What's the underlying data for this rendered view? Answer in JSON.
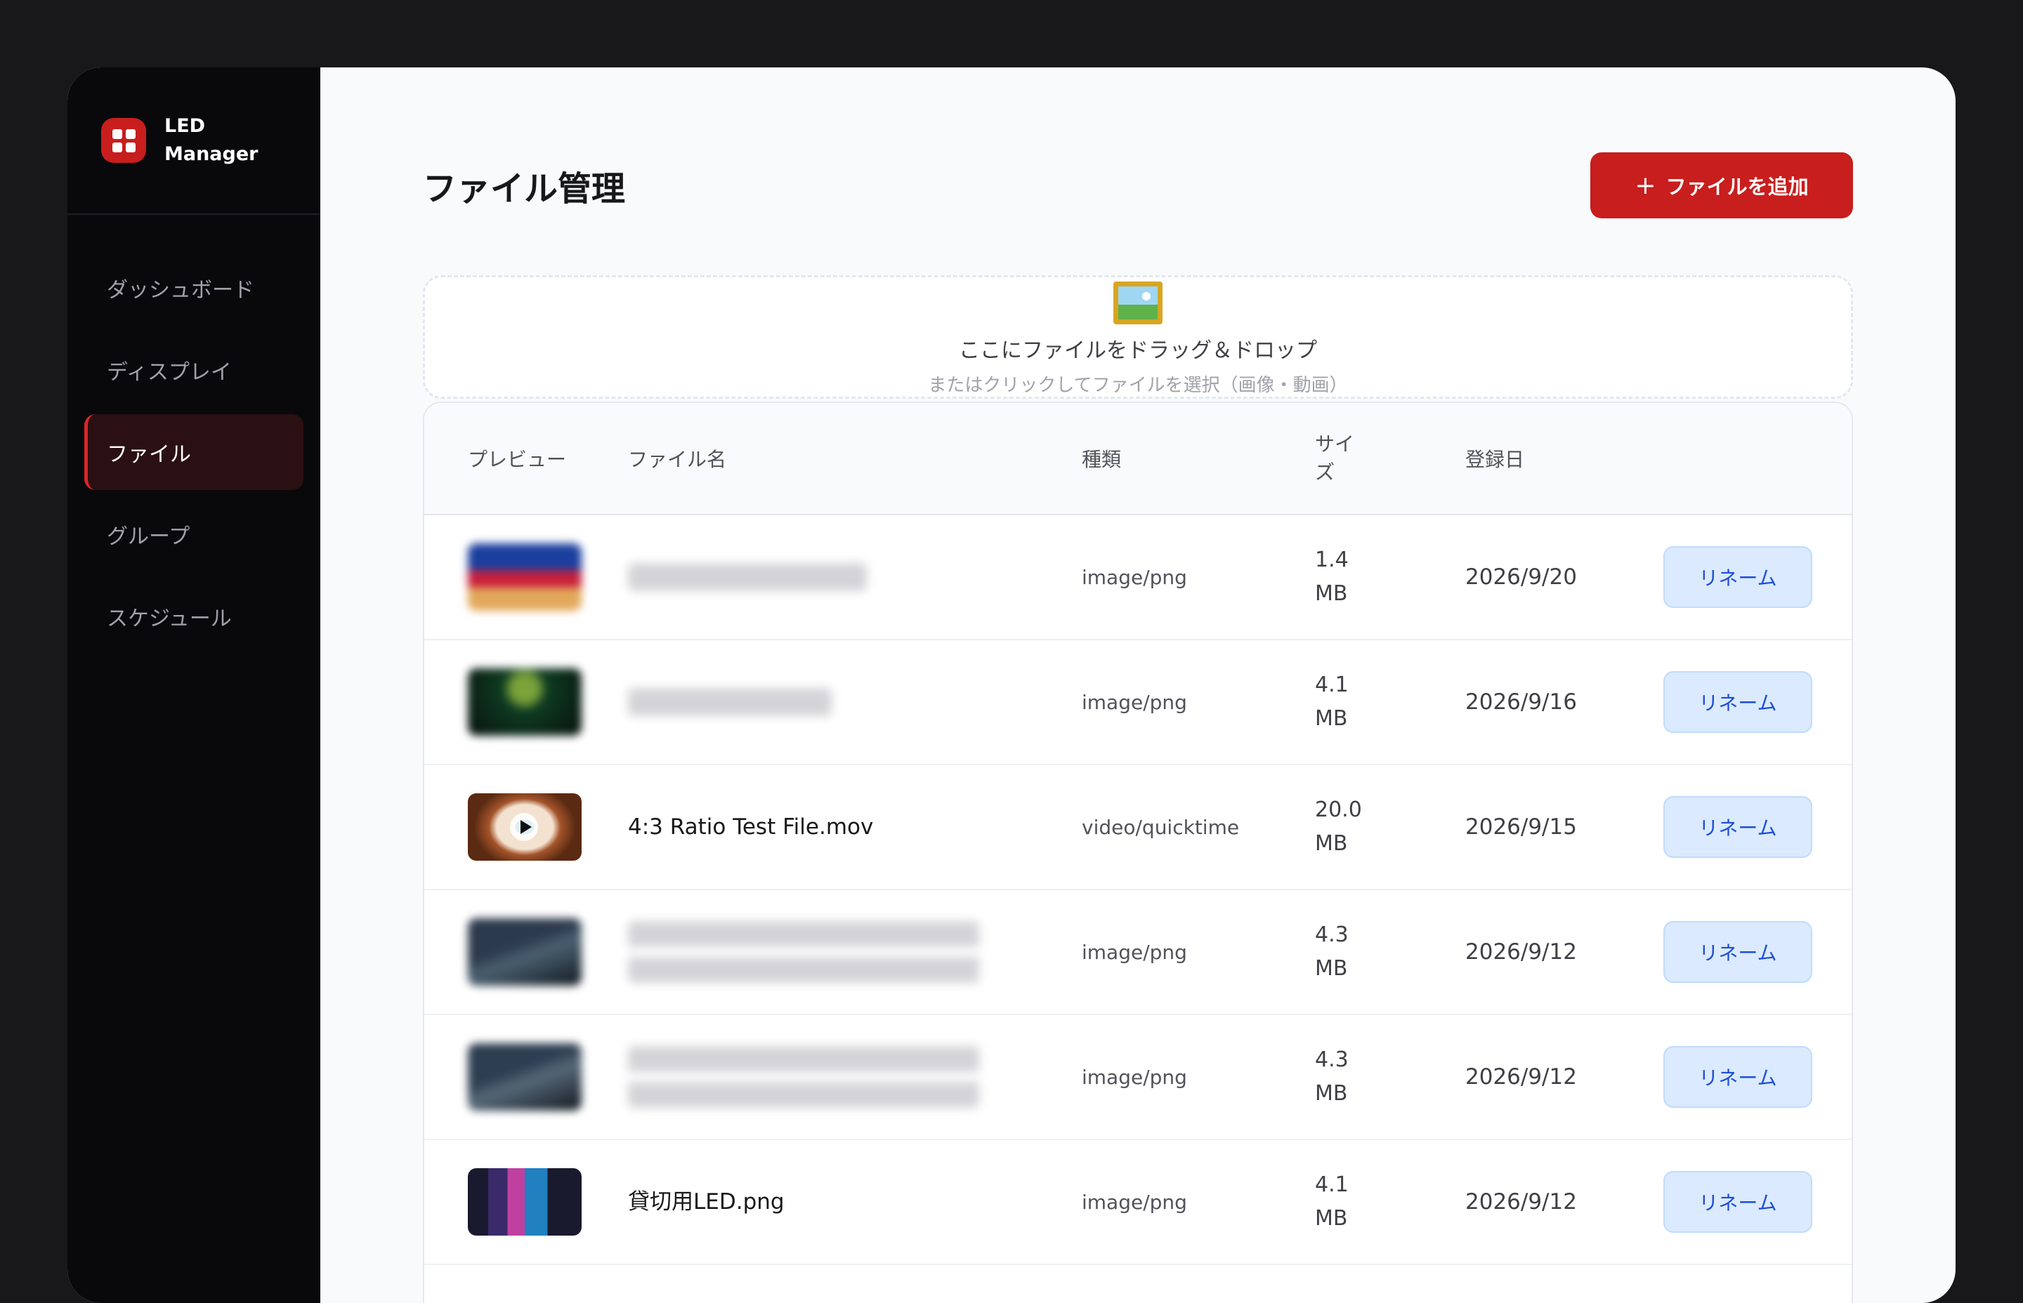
{
  "brand": {
    "line1": "LED",
    "line2": "Manager"
  },
  "nav": [
    {
      "label": "ダッシュボード",
      "active": false
    },
    {
      "label": "ディスプレイ",
      "active": false
    },
    {
      "label": "ファイル",
      "active": true
    },
    {
      "label": "グループ",
      "active": false
    },
    {
      "label": "スケジュール",
      "active": false
    }
  ],
  "header": {
    "title": "ファイル管理",
    "add_icon": "+",
    "add_label": "ファイルを追加"
  },
  "dropzone": {
    "icon": "framed-picture-icon",
    "main": "ここにファイルをドラッグ＆ドロップ",
    "sub": "またはクリックしてファイルを選択（画像・動画）"
  },
  "table": {
    "columns": {
      "preview": "プレビュー",
      "name": "ファイル名",
      "type": "種類",
      "size_line1": "サイ",
      "size_line2": "ズ",
      "date": "登録日"
    },
    "rows": [
      {
        "name": "",
        "type": "image/png",
        "size_num": "1.4",
        "size_unit": "MB",
        "date": "2026/9/20",
        "action": "リネーム",
        "blurred": true
      },
      {
        "name": "",
        "type": "image/png",
        "size_num": "4.1",
        "size_unit": "MB",
        "date": "2026/9/16",
        "action": "リネーム",
        "blurred": true
      },
      {
        "name": "4:3 Ratio Test File.mov",
        "type": "video/quicktime",
        "size_num": "20.0",
        "size_unit": "MB",
        "date": "2026/9/15",
        "action": "リネーム",
        "blurred": false
      },
      {
        "name": "",
        "type": "image/png",
        "size_num": "4.3",
        "size_unit": "MB",
        "date": "2026/9/12",
        "action": "リネーム",
        "blurred": true
      },
      {
        "name": "",
        "type": "image/png",
        "size_num": "4.3",
        "size_unit": "MB",
        "date": "2026/9/12",
        "action": "リネーム",
        "blurred": true
      },
      {
        "name": "貸切用LED.png",
        "type": "image/png",
        "size_num": "4.1",
        "size_unit": "MB",
        "date": "2026/9/12",
        "action": "リネーム",
        "blurred": false
      }
    ]
  },
  "colors": {
    "accent": "#c81e1e",
    "sidebar": "#09090b",
    "rename_bg": "#dbeafe",
    "rename_text": "#1d4ed8"
  }
}
